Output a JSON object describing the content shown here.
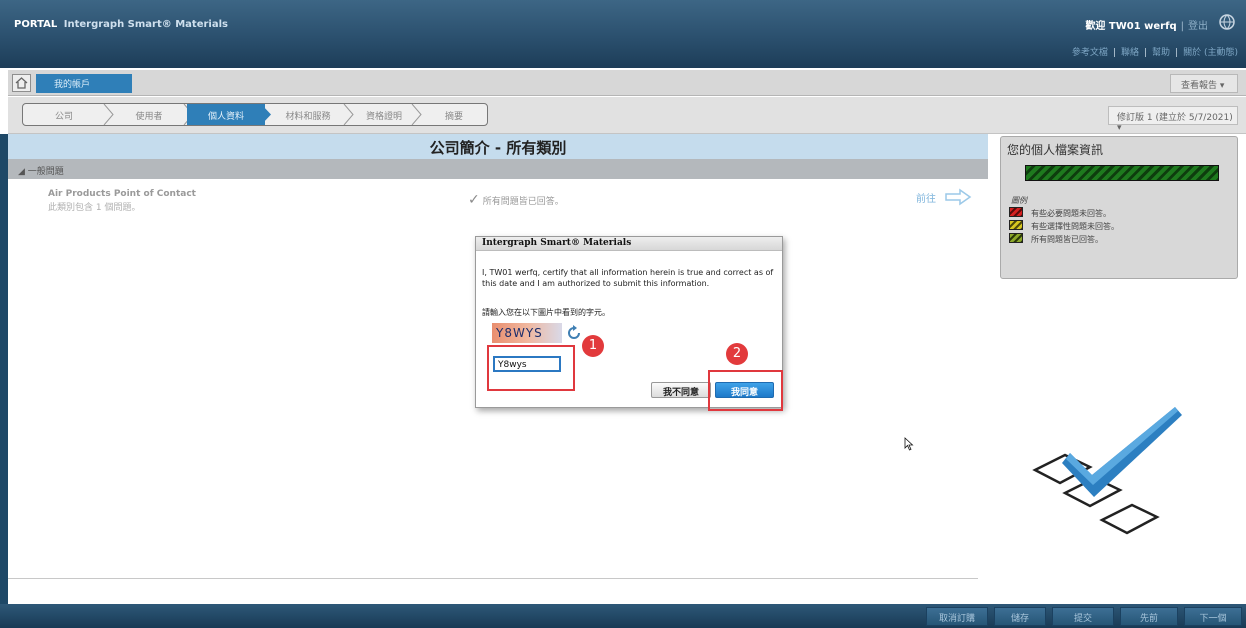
{
  "header": {
    "portal": "PORTAL",
    "product": "Intergraph Smart® Materials",
    "welcome": "歡迎 TW01 werfq",
    "separator": "|",
    "logout": "登出",
    "links": [
      "參考文檔",
      "聯絡",
      "幫助",
      "關於 (主動態)"
    ]
  },
  "toolbar": {
    "account_tab": "我的帳戶",
    "report_button": "查看報告"
  },
  "steps": [
    "公司",
    "使用者",
    "個人資料",
    "材料和服務",
    "資格證明",
    "摘要"
  ],
  "active_step": 2,
  "revision": "修訂版 1 (建立於 5/7/2021)",
  "main": {
    "title": "公司簡介 - 所有類別",
    "section": "一般問題",
    "item_title": "Air Products Point of Contact",
    "item_sub": "此類別包含 1 個問題。",
    "answered": "所有問題皆已回答。",
    "goto": "前往"
  },
  "panel": {
    "title": "您的個人檔案資訊",
    "progress_fraction": 1.0,
    "legend_title": "圖例",
    "legend": [
      {
        "label": "有些必要問題未回答。",
        "color": "#d62020"
      },
      {
        "label": "有些選擇性問題未回答。",
        "color": "#d6c620"
      },
      {
        "label": "所有問題皆已回答。",
        "color": "#4d7a12"
      }
    ]
  },
  "dialog": {
    "title": "Intergraph Smart® Materials",
    "certify_text": "I, TW01 werfq, certify that all information herein is true and correct as of this date and I am authorized to submit this information.",
    "captcha_prompt": "請輸入您在以下圖片中看到的字元。",
    "captcha_image_text": "Y8WYS",
    "captcha_value": "Y8wys",
    "disagree_label": "我不同意",
    "agree_label": "我同意"
  },
  "annotations": [
    "1",
    "2"
  ],
  "footer": {
    "buttons": [
      "取消訂購",
      "儲存",
      "提交",
      "先前",
      "下一個"
    ]
  }
}
